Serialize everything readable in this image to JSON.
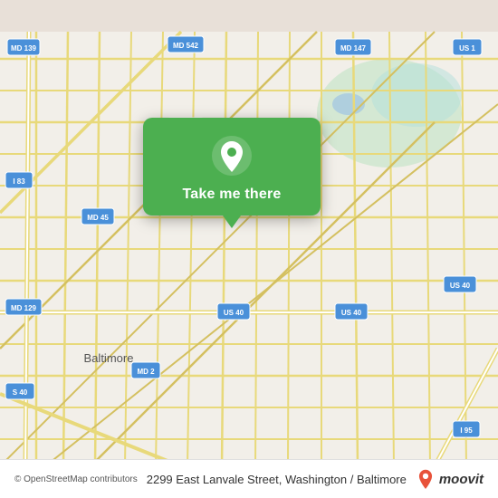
{
  "map": {
    "bg_color": "#f2efe9",
    "center_lat": 39.307,
    "center_lon": -76.595
  },
  "popup": {
    "label": "Take me there",
    "pin_color": "#ffffff",
    "bg_color": "#4caf50"
  },
  "bottom_bar": {
    "attribution": "© OpenStreetMap contributors",
    "address": "2299 East Lanvale Street, Washington / Baltimore",
    "logo_text": "moovit"
  },
  "road_labels": [
    "MD 139",
    "MD 542",
    "MD 147",
    "US 1",
    "I 83",
    "MD 45",
    "MD 129",
    "MD 2",
    "US 40",
    "S 40",
    "US 40",
    "I 95",
    "Baltimore"
  ]
}
